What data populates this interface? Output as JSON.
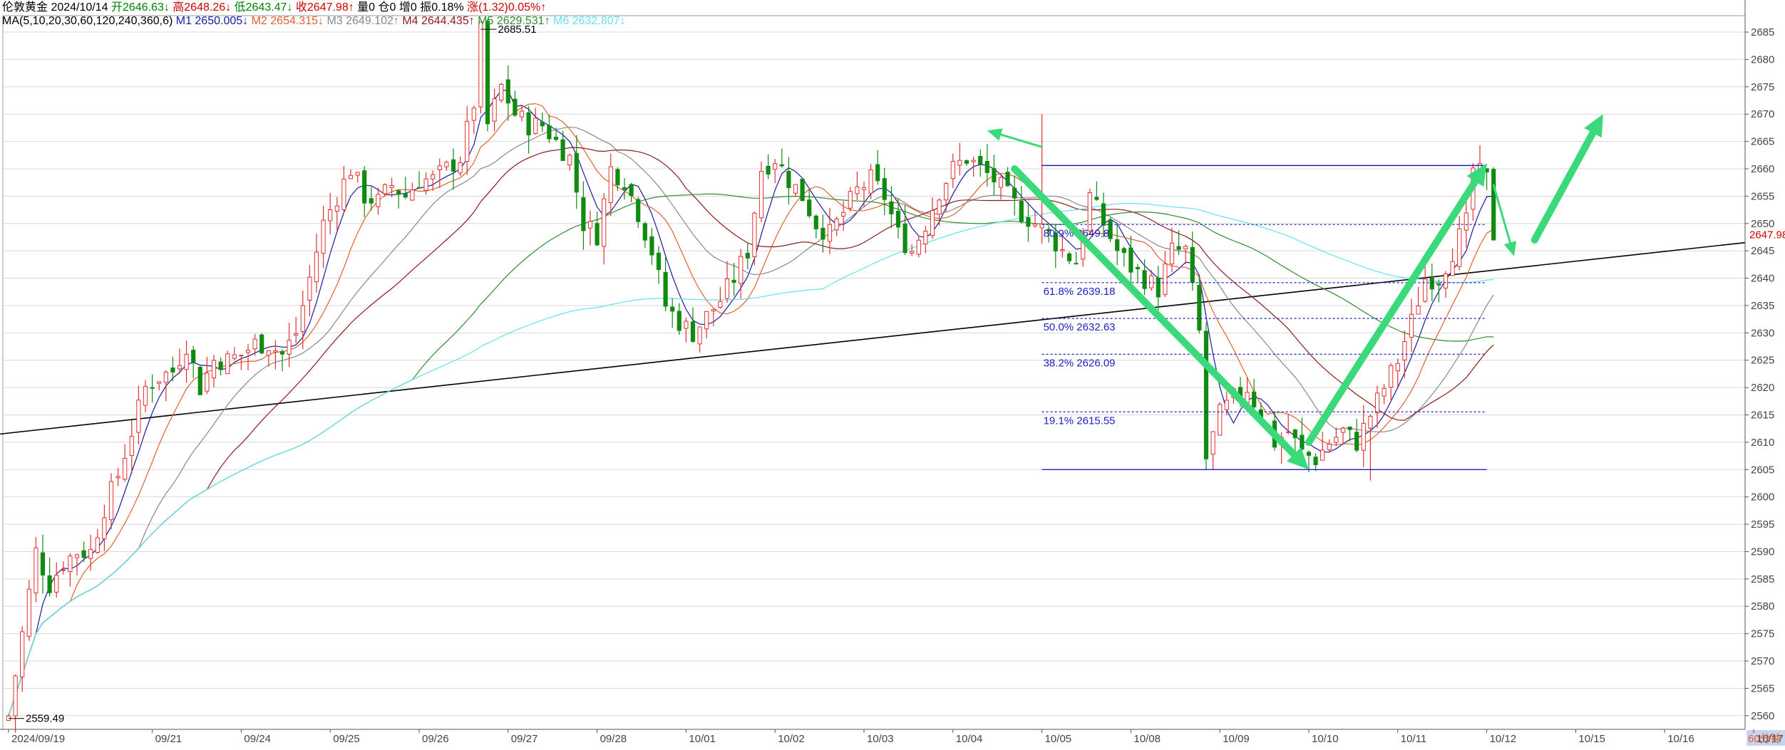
{
  "header": {
    "line1": [
      {
        "text": "伦敦黄金 2024/10/14",
        "color": "#000000"
      },
      {
        "text": "开2646.63↓",
        "color": "#008000"
      },
      {
        "text": "高2648.26↓",
        "color": "#cc0000"
      },
      {
        "text": "低2643.47↓",
        "color": "#008000"
      },
      {
        "text": "收2647.98↑",
        "color": "#cc0000"
      },
      {
        "text": "量0",
        "color": "#000000"
      },
      {
        "text": "仓0",
        "color": "#000000"
      },
      {
        "text": "增0",
        "color": "#000000"
      },
      {
        "text": "振0.18%",
        "color": "#000000"
      },
      {
        "text": "涨(1.32)0.05%↑",
        "color": "#cc0000"
      }
    ],
    "line2": [
      {
        "text": "MA(5,10,20,30,60,120,240,360,6)",
        "color": "#000000"
      },
      {
        "text": "M1 2650.005↓",
        "color": "#1a1aa0"
      },
      {
        "text": "M2 2654.315↓",
        "color": "#e06030"
      },
      {
        "text": "M3 2649.102↑",
        "color": "#888888"
      },
      {
        "text": "M4 2644.435↑",
        "color": "#8b1a1a"
      },
      {
        "text": "M5 2629.531↑",
        "color": "#2e8b2e"
      },
      {
        "text": "M6 2632.807↓",
        "color": "#66e0f0"
      }
    ]
  },
  "chart_data": {
    "type": "candlestick",
    "symbol": "伦敦黄金",
    "timeframe": "60分钟",
    "ylim": [
      2557.5,
      2688
    ],
    "y_ticks": [
      2560,
      2565,
      2570,
      2575,
      2580,
      2585,
      2590,
      2595,
      2600,
      2605,
      2610,
      2615,
      2620,
      2625,
      2630,
      2635,
      2640,
      2645,
      2650,
      2655,
      2660,
      2665,
      2670,
      2675,
      2680,
      2685
    ],
    "date_labels": [
      {
        "label": "2024/09/19",
        "bar": 0
      },
      {
        "label": "09/21",
        "bar": 21
      },
      {
        "label": "09/24",
        "bar": 34
      },
      {
        "label": "09/25",
        "bar": 47
      },
      {
        "label": "09/26",
        "bar": 60
      },
      {
        "label": "09/27",
        "bar": 73
      },
      {
        "label": "09/28",
        "bar": 86
      },
      {
        "label": "10/01",
        "bar": 99
      },
      {
        "label": "10/02",
        "bar": 112
      },
      {
        "label": "10/03",
        "bar": 125
      },
      {
        "label": "10/04",
        "bar": 138
      },
      {
        "label": "10/05",
        "bar": 151
      },
      {
        "label": "10/08",
        "bar": 164
      },
      {
        "label": "10/09",
        "bar": 177
      },
      {
        "label": "10/10",
        "bar": 190
      },
      {
        "label": "10/11",
        "bar": 203
      },
      {
        "label": "10/12",
        "bar": 216
      },
      {
        "label": "10/15",
        "bar": 229
      },
      {
        "label": "10/16",
        "bar": 242
      },
      {
        "label": "10/17",
        "bar": 255
      }
    ],
    "price_path": [
      [
        0,
        2560
      ],
      [
        2,
        2575
      ],
      [
        4,
        2590
      ],
      [
        6,
        2584
      ],
      [
        8,
        2588
      ],
      [
        10,
        2590
      ],
      [
        12,
        2590
      ],
      [
        14,
        2598
      ],
      [
        16,
        2604
      ],
      [
        18,
        2612
      ],
      [
        20,
        2620
      ],
      [
        22,
        2622
      ],
      [
        24,
        2623
      ],
      [
        26,
        2628
      ],
      [
        28,
        2620
      ],
      [
        30,
        2625
      ],
      [
        32,
        2625
      ],
      [
        34,
        2626
      ],
      [
        36,
        2628
      ],
      [
        38,
        2628
      ],
      [
        40,
        2626
      ],
      [
        42,
        2630
      ],
      [
        44,
        2640
      ],
      [
        46,
        2650
      ],
      [
        48,
        2655
      ],
      [
        50,
        2660
      ],
      [
        52,
        2655
      ],
      [
        54,
        2654
      ],
      [
        56,
        2657
      ],
      [
        58,
        2655
      ],
      [
        60,
        2658
      ],
      [
        62,
        2658
      ],
      [
        64,
        2660
      ],
      [
        66,
        2662
      ],
      [
        68,
        2672
      ],
      [
        69,
        2685
      ],
      [
        70,
        2668
      ],
      [
        72,
        2675
      ],
      [
        74,
        2670
      ],
      [
        76,
        2668
      ],
      [
        78,
        2668
      ],
      [
        80,
        2665
      ],
      [
        82,
        2662
      ],
      [
        84,
        2650
      ],
      [
        86,
        2648
      ],
      [
        88,
        2660
      ],
      [
        90,
        2658
      ],
      [
        92,
        2652
      ],
      [
        94,
        2645
      ],
      [
        96,
        2635
      ],
      [
        98,
        2632
      ],
      [
        100,
        2630
      ],
      [
        102,
        2633
      ],
      [
        104,
        2636
      ],
      [
        106,
        2640
      ],
      [
        108,
        2645
      ],
      [
        110,
        2660
      ],
      [
        112,
        2662
      ],
      [
        114,
        2658
      ],
      [
        116,
        2655
      ],
      [
        118,
        2650
      ],
      [
        120,
        2648
      ],
      [
        122,
        2652
      ],
      [
        124,
        2656
      ],
      [
        126,
        2658
      ],
      [
        128,
        2655
      ],
      [
        130,
        2648
      ],
      [
        132,
        2645
      ],
      [
        134,
        2650
      ],
      [
        136,
        2656
      ],
      [
        138,
        2660
      ],
      [
        140,
        2662
      ],
      [
        142,
        2660
      ],
      [
        144,
        2658
      ],
      [
        146,
        2655
      ],
      [
        148,
        2652
      ],
      [
        150,
        2650
      ],
      [
        152,
        2648
      ],
      [
        154,
        2645
      ],
      [
        156,
        2643
      ],
      [
        158,
        2655
      ],
      [
        160,
        2650
      ],
      [
        162,
        2645
      ],
      [
        164,
        2642
      ],
      [
        166,
        2640
      ],
      [
        168,
        2638
      ],
      [
        170,
        2645
      ],
      [
        172,
        2645
      ],
      [
        174,
        2630
      ],
      [
        175,
        2607
      ],
      [
        177,
        2615
      ],
      [
        179,
        2618
      ],
      [
        181,
        2620
      ],
      [
        183,
        2615
      ],
      [
        185,
        2610
      ],
      [
        187,
        2612
      ],
      [
        189,
        2608
      ],
      [
        191,
        2607
      ],
      [
        193,
        2610
      ],
      [
        195,
        2612
      ],
      [
        197,
        2610
      ],
      [
        199,
        2615
      ],
      [
        201,
        2620
      ],
      [
        203,
        2625
      ],
      [
        205,
        2632
      ],
      [
        207,
        2640
      ],
      [
        209,
        2640
      ],
      [
        211,
        2645
      ],
      [
        213,
        2650
      ],
      [
        214,
        2660
      ],
      [
        216,
        2658
      ],
      [
        217,
        2647.98
      ]
    ],
    "price_high": 2685.51,
    "price_low": 2559.49,
    "ma_lines": [
      {
        "name": "M1",
        "color": "#1a1aa0",
        "value": 2650.005
      },
      {
        "name": "M2",
        "color": "#e06030",
        "value": 2654.315
      },
      {
        "name": "M3",
        "color": "#888888",
        "value": 2649.102
      },
      {
        "name": "M4",
        "color": "#8b1a1a",
        "value": 2644.435
      },
      {
        "name": "M5",
        "color": "#2e8b2e",
        "value": 2629.531
      },
      {
        "name": "M6",
        "color": "#66e0f0",
        "value": 2632.807
      }
    ],
    "fibonacci": {
      "start_bar": 151,
      "end_bar": 216,
      "top": 2660.6,
      "bottom": 2605.0,
      "levels": [
        {
          "label": "80.9% 2649.8",
          "value": 2649.8
        },
        {
          "label": "61.8% 2639.18",
          "value": 2639.18
        },
        {
          "label": "50.0% 2632.63",
          "value": 2632.63
        },
        {
          "label": "38.2% 2626.09",
          "value": 2626.09
        },
        {
          "label": "19.1% 2615.55",
          "value": 2615.55
        }
      ]
    },
    "trendline": {
      "from": [
        0,
        2611.5
      ],
      "to": [
        255,
        2646.5
      ]
    },
    "arrows": [
      {
        "from": [
          151,
          2664
        ],
        "to": [
          143,
          2667
        ]
      },
      {
        "from": [
          147,
          2660
        ],
        "to": [
          190,
          2605
        ]
      },
      {
        "from": [
          190,
          2610
        ],
        "to": [
          216,
          2661
        ]
      },
      {
        "from": [
          217,
          2657
        ],
        "to": [
          220,
          2644
        ]
      },
      {
        "from": [
          223,
          2647
        ],
        "to": [
          233,
          2670
        ]
      }
    ],
    "current_price_label": "2647.98",
    "current_price_color": "#cc0000",
    "annotations": [
      {
        "text": "2685.51",
        "bar": 69,
        "value": 2685.51
      },
      {
        "text": "2559.49",
        "bar": 0,
        "value": 2559.49
      }
    ]
  }
}
